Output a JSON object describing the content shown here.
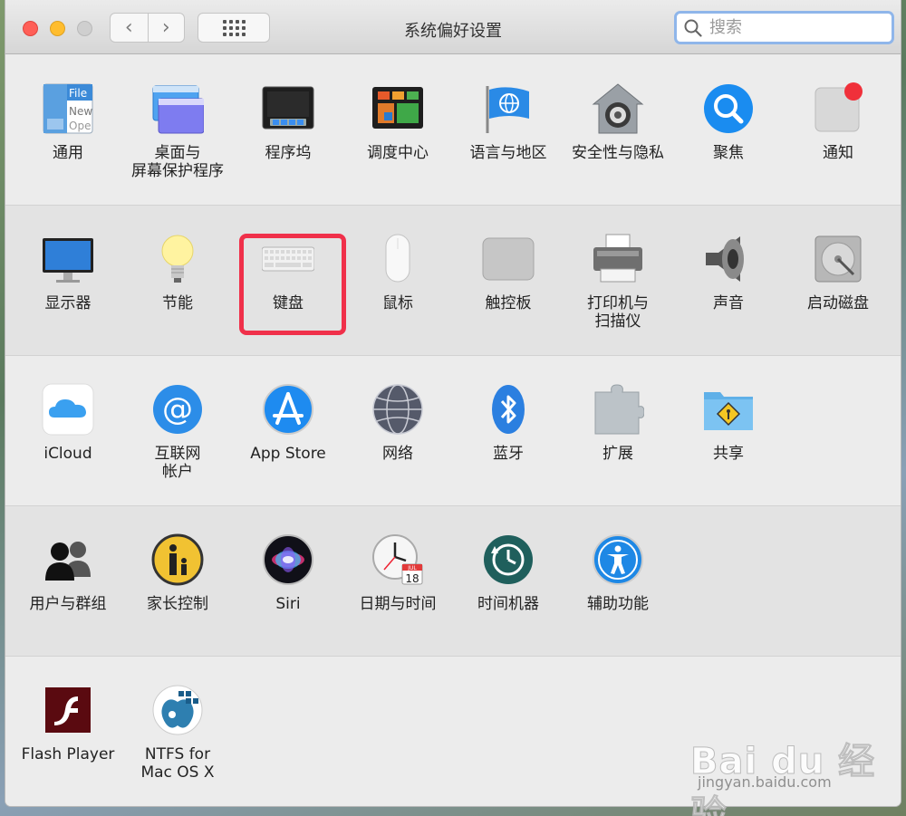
{
  "window": {
    "title": "系统偏好设置"
  },
  "search": {
    "placeholder": "搜索"
  },
  "sections": [
    [
      {
        "name": "general",
        "label": "通用"
      },
      {
        "name": "desktop-screensaver",
        "label": "桌面与\n屏幕保护程序"
      },
      {
        "name": "dock",
        "label": "程序坞"
      },
      {
        "name": "mission-control",
        "label": "调度中心"
      },
      {
        "name": "language-region",
        "label": "语言与地区"
      },
      {
        "name": "security-privacy",
        "label": "安全性与隐私"
      },
      {
        "name": "spotlight",
        "label": "聚焦"
      },
      {
        "name": "notifications",
        "label": "通知"
      }
    ],
    [
      {
        "name": "displays",
        "label": "显示器"
      },
      {
        "name": "energy-saver",
        "label": "节能"
      },
      {
        "name": "keyboard",
        "label": "键盘"
      },
      {
        "name": "mouse",
        "label": "鼠标"
      },
      {
        "name": "trackpad",
        "label": "触控板"
      },
      {
        "name": "printers-scanners",
        "label": "打印机与\n扫描仪"
      },
      {
        "name": "sound",
        "label": "声音"
      },
      {
        "name": "startup-disk",
        "label": "启动磁盘"
      }
    ],
    [
      {
        "name": "icloud",
        "label": "iCloud"
      },
      {
        "name": "internet-accounts",
        "label": "互联网\n帐户"
      },
      {
        "name": "app-store",
        "label": "App Store"
      },
      {
        "name": "network",
        "label": "网络"
      },
      {
        "name": "bluetooth",
        "label": "蓝牙"
      },
      {
        "name": "extensions",
        "label": "扩展"
      },
      {
        "name": "sharing",
        "label": "共享"
      }
    ],
    [
      {
        "name": "users-groups",
        "label": "用户与群组"
      },
      {
        "name": "parental-controls",
        "label": "家长控制"
      },
      {
        "name": "siri",
        "label": "Siri"
      },
      {
        "name": "date-time",
        "label": "日期与时间"
      },
      {
        "name": "time-machine",
        "label": "时间机器"
      },
      {
        "name": "accessibility",
        "label": "辅助功能"
      }
    ],
    [
      {
        "name": "flash-player",
        "label": "Flash Player"
      },
      {
        "name": "ntfs-for-mac",
        "label": "NTFS for\nMac OS X"
      }
    ]
  ],
  "icons": {
    "general": {
      "file_text": "File",
      "new_text": "New",
      "open_text": "Ope"
    },
    "date_time": {
      "month": "JUL",
      "day": "18"
    }
  },
  "watermark": {
    "brand": "Bai du 经验",
    "url": "jingyan.baidu.com"
  },
  "colors": {
    "highlight": "#f0304a",
    "search_focus": "#8fb6ea"
  }
}
